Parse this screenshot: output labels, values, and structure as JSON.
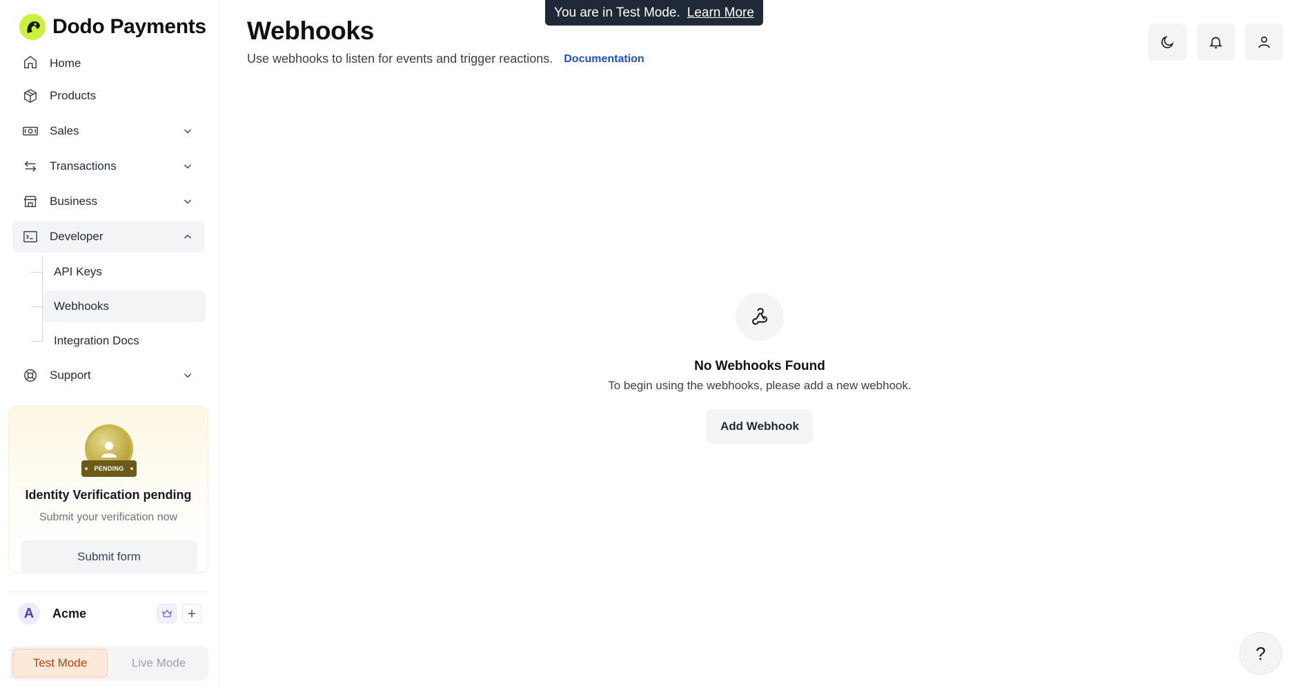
{
  "brand": {
    "name": "Dodo Payments",
    "logo_color": "#c9f23a"
  },
  "sidebar": {
    "items": [
      {
        "label": "Home",
        "icon": "home-icon"
      },
      {
        "label": "Products",
        "icon": "box-icon"
      },
      {
        "label": "Sales",
        "icon": "cash-icon"
      },
      {
        "label": "Transactions",
        "icon": "arrows-icon"
      },
      {
        "label": "Business",
        "icon": "store-icon"
      },
      {
        "label": "Developer",
        "icon": "terminal-icon"
      },
      {
        "label": "Support",
        "icon": "lifebuoy-icon"
      }
    ],
    "developer_sub": [
      {
        "label": "API Keys"
      },
      {
        "label": "Webhooks"
      },
      {
        "label": "Integration Docs"
      }
    ]
  },
  "verification": {
    "badge": "PENDING",
    "title": "Identity Verification pending",
    "subtitle": "Submit your verification now",
    "button": "Submit form"
  },
  "org": {
    "avatar": "A",
    "name": "Acme"
  },
  "mode": {
    "test": "Test Mode",
    "live": "Live Mode",
    "active": "test"
  },
  "banner": {
    "text": "You are in Test Mode.",
    "link": "Learn More"
  },
  "header": {
    "title": "Webhooks",
    "subtitle": "Use webhooks to listen for events and trigger reactions.",
    "doc_link": "Documentation"
  },
  "empty": {
    "title": "No Webhooks Found",
    "subtitle": "To begin using the webhooks, please add a new webhook.",
    "button": "Add Webhook"
  },
  "help": "?",
  "colors": {
    "accent_link": "#1d4ed8",
    "test_mode": "#c2410c"
  }
}
